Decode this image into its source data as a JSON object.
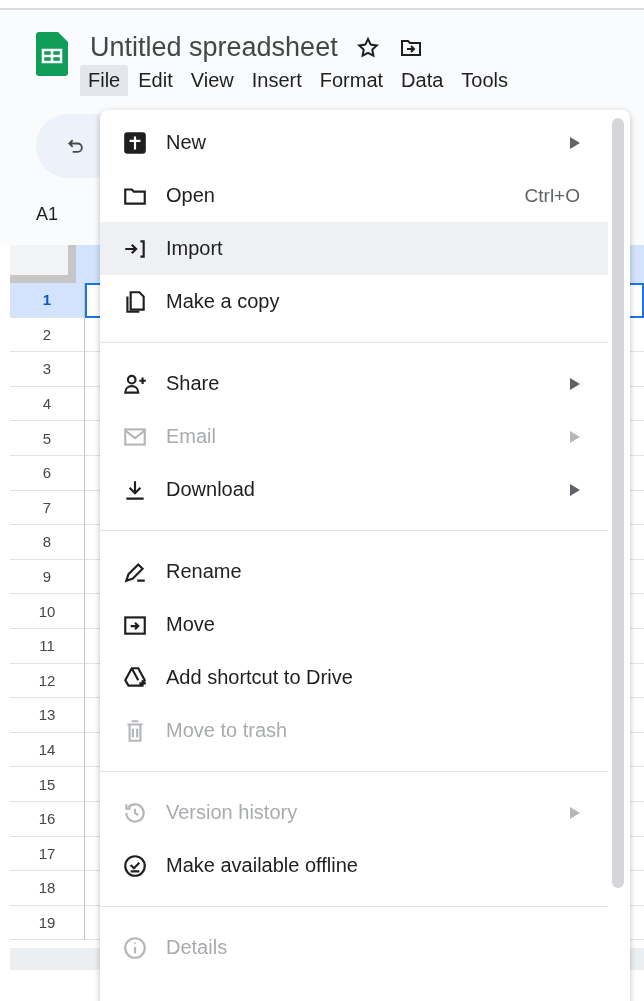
{
  "document": {
    "title": "Untitled spreadsheet"
  },
  "menubar": [
    {
      "label": "File",
      "selected": true
    },
    {
      "label": "Edit",
      "selected": false
    },
    {
      "label": "View",
      "selected": false
    },
    {
      "label": "Insert",
      "selected": false
    },
    {
      "label": "Format",
      "selected": false
    },
    {
      "label": "Data",
      "selected": false
    },
    {
      "label": "Tools",
      "selected": false
    }
  ],
  "name_box": "A1",
  "row_headers": [
    {
      "label": "1",
      "selected": true
    },
    {
      "label": "2",
      "selected": false
    },
    {
      "label": "3",
      "selected": false
    },
    {
      "label": "4",
      "selected": false
    },
    {
      "label": "5",
      "selected": false
    },
    {
      "label": "6",
      "selected": false
    },
    {
      "label": "7",
      "selected": false
    },
    {
      "label": "8",
      "selected": false
    },
    {
      "label": "9",
      "selected": false
    },
    {
      "label": "10",
      "selected": false
    },
    {
      "label": "11",
      "selected": false
    },
    {
      "label": "12",
      "selected": false
    },
    {
      "label": "13",
      "selected": false
    },
    {
      "label": "14",
      "selected": false
    },
    {
      "label": "15",
      "selected": false
    },
    {
      "label": "16",
      "selected": false
    },
    {
      "label": "17",
      "selected": false
    },
    {
      "label": "18",
      "selected": false
    },
    {
      "label": "19",
      "selected": false
    }
  ],
  "file_menu": {
    "sections": [
      {
        "items": [
          {
            "label": "New",
            "submenu": true,
            "disabled": false,
            "highlighted": false
          },
          {
            "label": "Open",
            "shortcut": "Ctrl+O",
            "submenu": false,
            "disabled": false,
            "highlighted": false
          },
          {
            "label": "Import",
            "submenu": false,
            "disabled": false,
            "highlighted": true
          },
          {
            "label": "Make a copy",
            "submenu": false,
            "disabled": false,
            "highlighted": false
          }
        ]
      },
      {
        "items": [
          {
            "label": "Share",
            "submenu": true,
            "disabled": false,
            "highlighted": false
          },
          {
            "label": "Email",
            "submenu": true,
            "disabled": true,
            "highlighted": false
          },
          {
            "label": "Download",
            "submenu": true,
            "disabled": false,
            "highlighted": false
          }
        ]
      },
      {
        "items": [
          {
            "label": "Rename",
            "submenu": false,
            "disabled": false,
            "highlighted": false
          },
          {
            "label": "Move",
            "submenu": false,
            "disabled": false,
            "highlighted": false
          },
          {
            "label": "Add shortcut to Drive",
            "submenu": false,
            "disabled": false,
            "highlighted": false
          },
          {
            "label": "Move to trash",
            "submenu": false,
            "disabled": true,
            "highlighted": false
          }
        ]
      },
      {
        "items": [
          {
            "label": "Version history",
            "submenu": true,
            "disabled": true,
            "highlighted": false
          },
          {
            "label": "Make available offline",
            "submenu": false,
            "disabled": false,
            "highlighted": false
          }
        ]
      },
      {
        "items": [
          {
            "label": "Details",
            "submenu": false,
            "disabled": true,
            "highlighted": false
          }
        ]
      }
    ]
  }
}
